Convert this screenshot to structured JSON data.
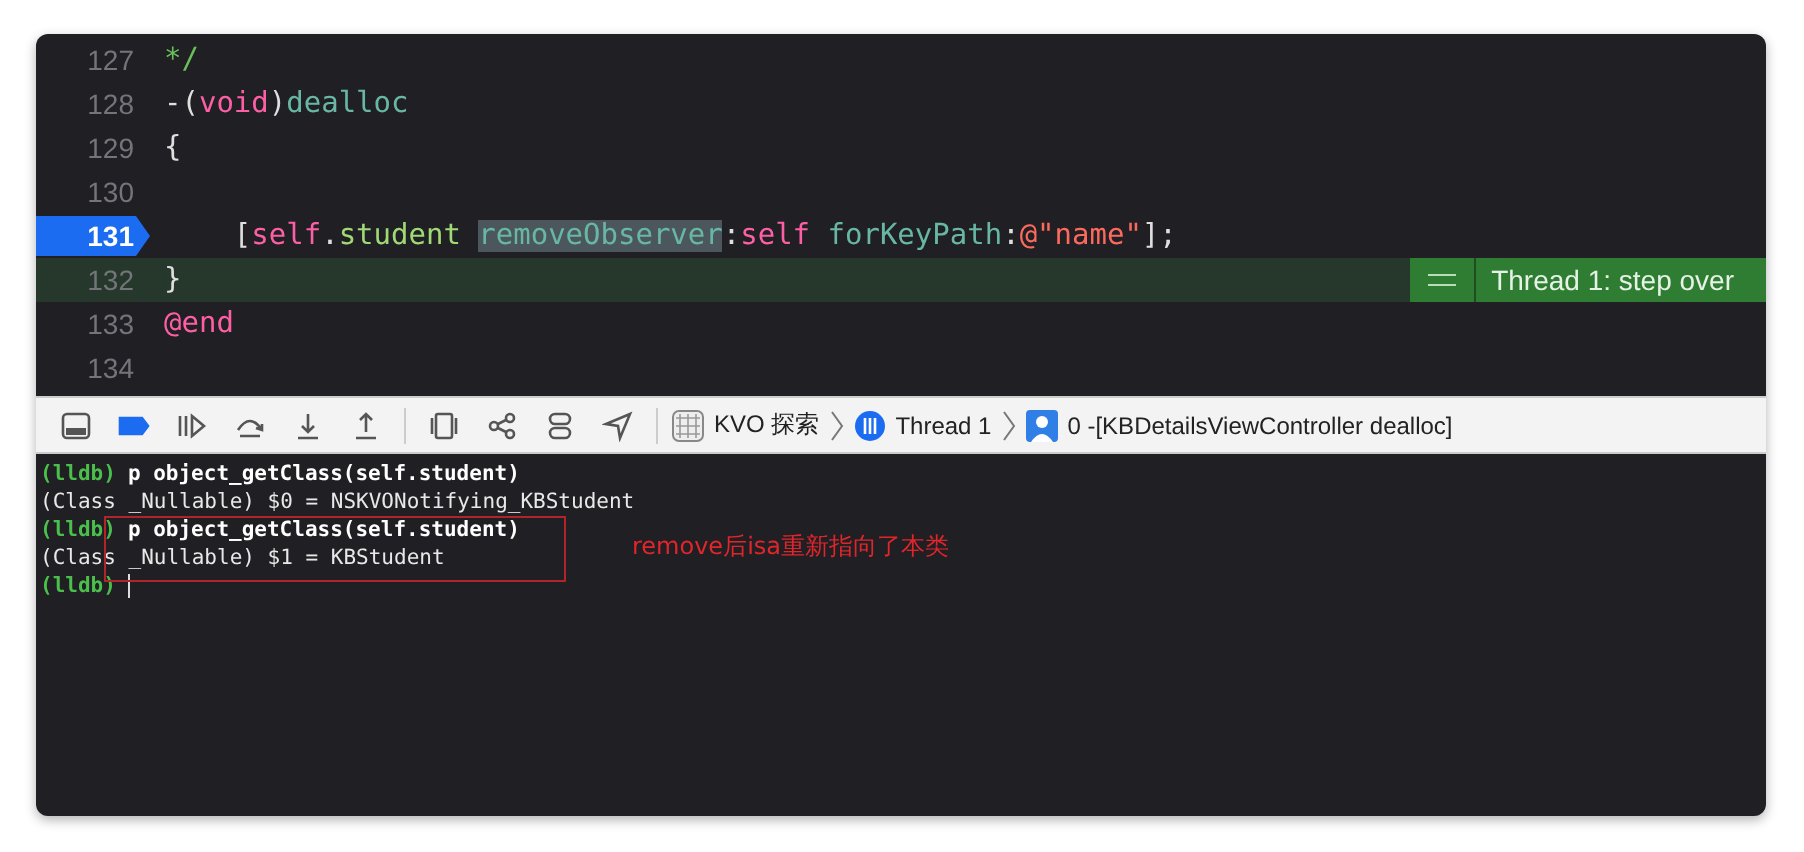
{
  "editor": {
    "lines": [
      {
        "number": "127",
        "current": false,
        "stopped": false,
        "tokens": [
          {
            "kind": "comment",
            "text": "*/",
            "highlighted": false
          }
        ]
      },
      {
        "number": "128",
        "current": false,
        "stopped": false,
        "tokens": [
          {
            "kind": "plain",
            "text": "-(",
            "highlighted": false
          },
          {
            "kind": "keyword",
            "text": "void",
            "highlighted": false
          },
          {
            "kind": "plain",
            "text": ")",
            "highlighted": false
          },
          {
            "kind": "method",
            "text": "dealloc",
            "highlighted": false
          }
        ]
      },
      {
        "number": "129",
        "current": false,
        "stopped": false,
        "tokens": [
          {
            "kind": "plain",
            "text": "{",
            "highlighted": false
          }
        ]
      },
      {
        "number": "130",
        "current": false,
        "stopped": false
      },
      {
        "number": "131",
        "current": true,
        "stopped": false,
        "tokens": [
          {
            "kind": "plain",
            "text": "    [",
            "highlighted": false
          },
          {
            "kind": "keyword",
            "text": "self",
            "highlighted": false
          },
          {
            "kind": "plain",
            "text": ".",
            "highlighted": false
          },
          {
            "kind": "property",
            "text": "student ",
            "highlighted": false
          },
          {
            "kind": "method",
            "text": "removeObserver",
            "highlighted": true
          },
          {
            "kind": "plain",
            "text": ":",
            "highlighted": false
          },
          {
            "kind": "keyword",
            "text": "self ",
            "highlighted": false
          },
          {
            "kind": "method",
            "text": "forKeyPath",
            "highlighted": false
          },
          {
            "kind": "plain",
            "text": ":",
            "highlighted": false
          },
          {
            "kind": "string",
            "text": "@\"name\"",
            "highlighted": false
          },
          {
            "kind": "plain",
            "text": "];",
            "highlighted": false
          }
        ]
      },
      {
        "number": "132",
        "current": false,
        "stopped": true,
        "tokens": [
          {
            "kind": "plain",
            "text": "}",
            "highlighted": false
          }
        ],
        "badge": "Thread 1: step over"
      },
      {
        "number": "133",
        "current": false,
        "stopped": false,
        "tokens": [
          {
            "kind": "keyword",
            "text": "@end",
            "highlighted": false
          }
        ]
      },
      {
        "number": "134",
        "current": false,
        "stopped": false
      }
    ]
  },
  "debug_bar": {
    "buttons": [
      {
        "kind": "panel",
        "active": false
      },
      {
        "kind": "breakpoints",
        "active": true
      },
      {
        "kind": "continue",
        "active": false
      },
      {
        "kind": "step-over",
        "active": false
      },
      {
        "kind": "step-into",
        "active": false
      },
      {
        "kind": "step-out",
        "active": false
      },
      {
        "kind": "view-debugger",
        "active": false
      },
      {
        "kind": "memory-graph",
        "active": false
      },
      {
        "kind": "environment",
        "active": false
      },
      {
        "kind": "location",
        "active": false
      }
    ],
    "breadcrumbs": [
      {
        "kind": "app",
        "text": "KVO 探索"
      },
      {
        "kind": "thread",
        "text": "Thread 1"
      },
      {
        "kind": "frame",
        "text": "0 -[KBDetailsViewController dealloc]"
      }
    ]
  },
  "console": {
    "lines": [
      {
        "kind": "command",
        "prompt": "(lldb)",
        "text": "p object_getClass(self.student)"
      },
      {
        "kind": "output",
        "text": "(Class _Nullable) $0 = NSKVONotifying_KBStudent"
      },
      {
        "kind": "command",
        "prompt": "(lldb)",
        "text": "p object_getClass(self.student)"
      },
      {
        "kind": "output",
        "text": "(Class _Nullable) $1 = KBStudent"
      },
      {
        "kind": "input",
        "prompt": "(lldb)"
      }
    ],
    "annotation": {
      "text": "remove后isa重新指向了本类"
    }
  }
}
